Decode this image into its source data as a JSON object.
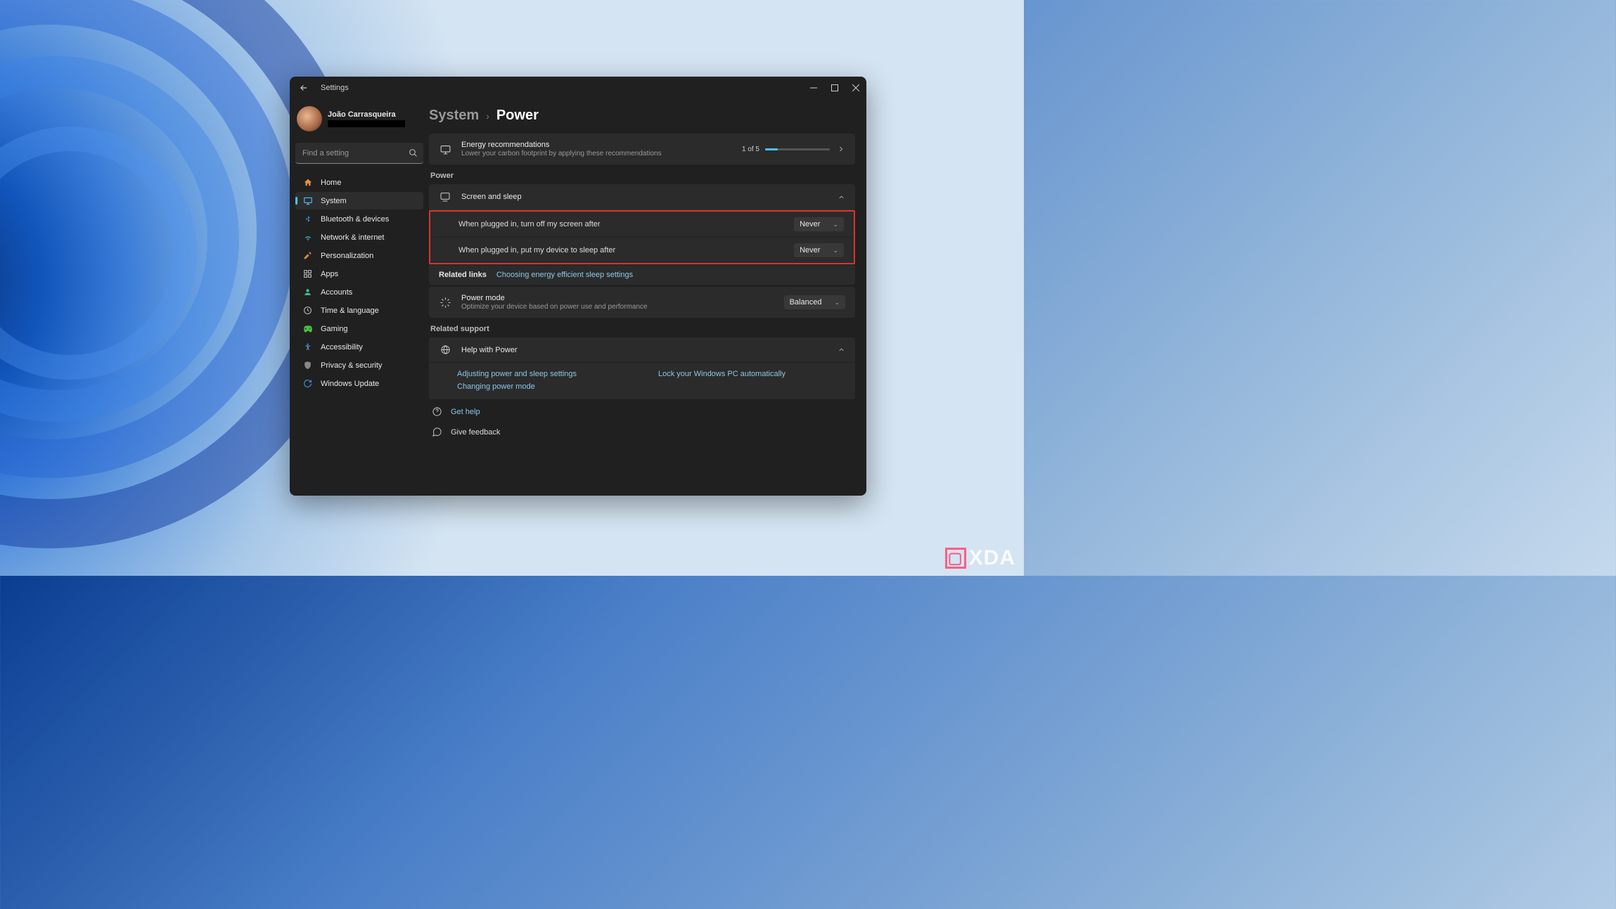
{
  "app": {
    "title": "Settings"
  },
  "profile": {
    "name": "João Carrasqueira"
  },
  "search": {
    "placeholder": "Find a setting"
  },
  "sidebar": {
    "items": [
      {
        "label": "Home",
        "icon": "home-icon",
        "color": "#e89040"
      },
      {
        "label": "System",
        "icon": "system-icon",
        "color": "#4cc2ff",
        "active": true
      },
      {
        "label": "Bluetooth & devices",
        "icon": "bluetooth-icon",
        "color": "#3a8ee6"
      },
      {
        "label": "Network & internet",
        "icon": "network-icon",
        "color": "#38b0d0"
      },
      {
        "label": "Personalization",
        "icon": "personalization-icon",
        "color": "#d08848"
      },
      {
        "label": "Apps",
        "icon": "apps-icon",
        "color": "#bbb"
      },
      {
        "label": "Accounts",
        "icon": "accounts-icon",
        "color": "#3cc090"
      },
      {
        "label": "Time & language",
        "icon": "time-language-icon",
        "color": "#bbb"
      },
      {
        "label": "Gaming",
        "icon": "gaming-icon",
        "color": "#48c048"
      },
      {
        "label": "Accessibility",
        "icon": "accessibility-icon",
        "color": "#5898d8"
      },
      {
        "label": "Privacy & security",
        "icon": "privacy-icon",
        "color": "#888"
      },
      {
        "label": "Windows Update",
        "icon": "update-icon",
        "color": "#3a9ee0"
      }
    ]
  },
  "breadcrumb": {
    "parent": "System",
    "current": "Power"
  },
  "energy": {
    "title": "Energy recommendations",
    "sub": "Lower your carbon footprint by applying these recommendations",
    "progress_text": "1 of 5",
    "progress_pct": 20
  },
  "sections": {
    "power_label": "Power",
    "screen_sleep": {
      "title": "Screen and sleep",
      "screen_off_label": "When plugged in, turn off my screen after",
      "screen_off_value": "Never",
      "sleep_label": "When plugged in, put my device to sleep after",
      "sleep_value": "Never"
    },
    "related_links": {
      "label": "Related links",
      "link1": "Choosing energy efficient sleep settings"
    },
    "power_mode": {
      "title": "Power mode",
      "sub": "Optimize your device based on power use and performance",
      "value": "Balanced"
    },
    "related_support_label": "Related support",
    "help": {
      "title": "Help with Power",
      "links": {
        "a": "Adjusting power and sleep settings",
        "b": "Lock your Windows PC automatically",
        "c": "Changing power mode"
      }
    }
  },
  "footer": {
    "get_help": "Get help",
    "feedback": "Give feedback"
  },
  "watermark": "XDA"
}
